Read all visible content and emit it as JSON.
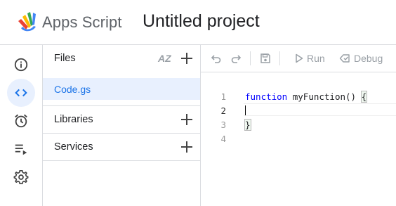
{
  "header": {
    "app_name": "Apps Script",
    "project_title": "Untitled project"
  },
  "rail": {
    "items": [
      {
        "name": "overview",
        "icon": "info-icon",
        "active": false
      },
      {
        "name": "editor",
        "icon": "code-icon",
        "active": true
      },
      {
        "name": "triggers",
        "icon": "alarm-clock-icon",
        "active": false
      },
      {
        "name": "executions",
        "icon": "playlist-play-icon",
        "active": false
      },
      {
        "name": "settings",
        "icon": "gear-icon",
        "active": false
      }
    ]
  },
  "panel": {
    "files_label": "Files",
    "sort_label": "AZ",
    "files": [
      "Code.gs"
    ],
    "libraries_label": "Libraries",
    "services_label": "Services"
  },
  "toolbar": {
    "run_label": "Run",
    "debug_label": "Debug"
  },
  "editor": {
    "line_numbers": [
      "1",
      "2",
      "3",
      "4"
    ],
    "lines": {
      "keyword": "function",
      "signature": " myFunction() ",
      "open_brace": "{",
      "close_brace": "}"
    }
  },
  "colors": {
    "accent": "#1a73e8",
    "active_bg": "#e8f0fe",
    "keyword": "#0000ff",
    "border": "#dadce0"
  }
}
